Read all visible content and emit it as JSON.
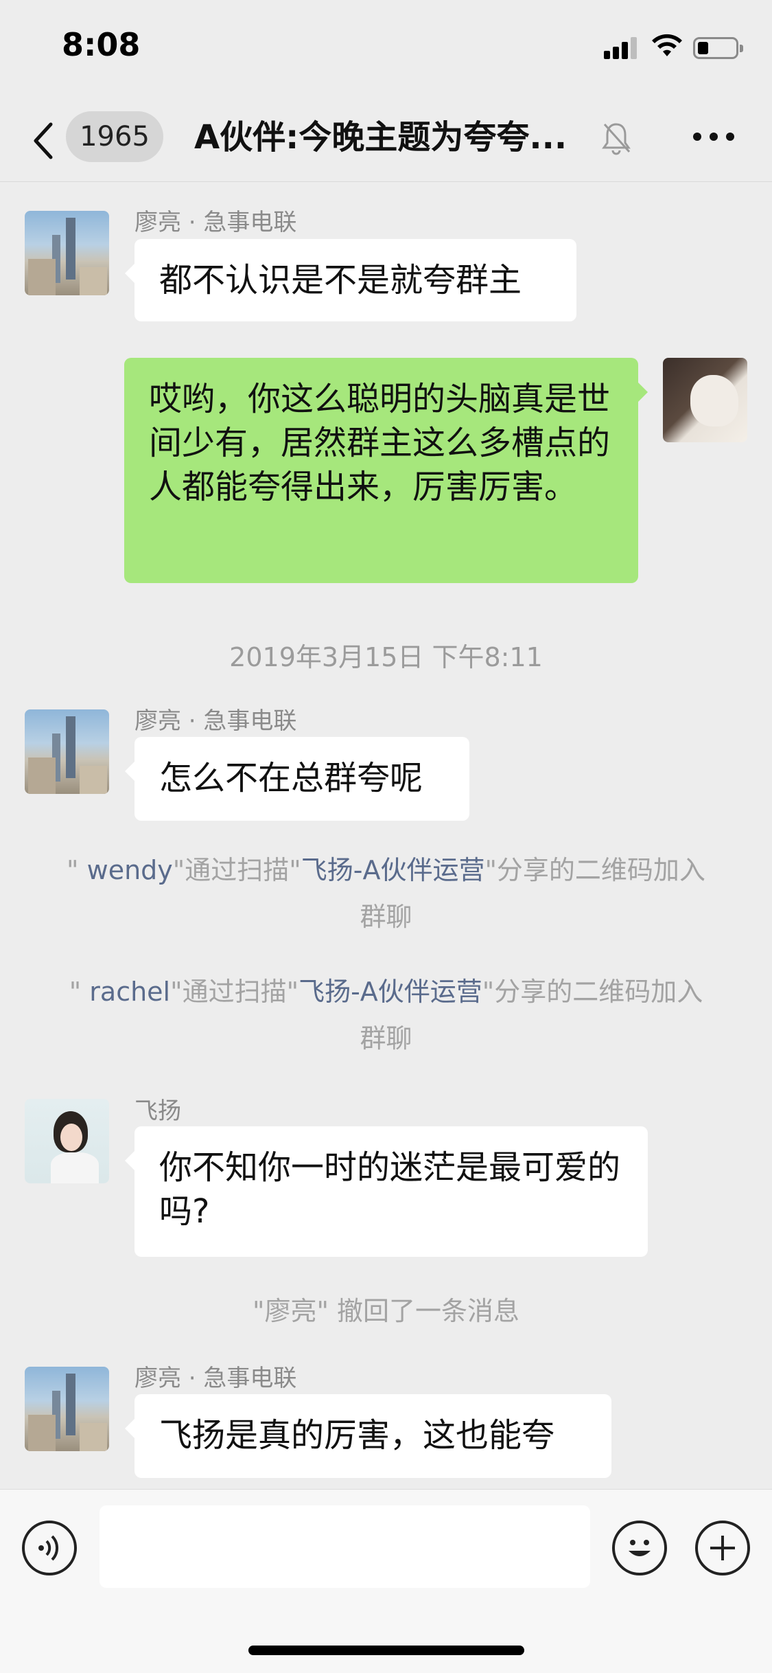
{
  "status_bar": {
    "time": "8:08"
  },
  "nav": {
    "unread_count": "1965",
    "title": "A伙伴:今晚主题为夸夸..."
  },
  "messages": [
    {
      "sender": "廖亮 · 急事电联",
      "text": "都不认识是不是就夸群主",
      "direction": "incoming"
    },
    {
      "text": "哎哟，你这么聪明的头脑真是世间少有，居然群主这么多槽点的人都能夸得出来，厉害厉害。",
      "direction": "outgoing"
    },
    {
      "sender": "廖亮 · 急事电联",
      "text": "怎么不在总群夸呢",
      "direction": "incoming"
    },
    {
      "sender": "飞扬",
      "text": "你不知你一时的迷茫是最可爱的吗?",
      "direction": "incoming"
    },
    {
      "sender": "廖亮 · 急事电联",
      "text": "飞扬是真的厉害，这也能夸",
      "direction": "incoming"
    }
  ],
  "timestamp": "2019年3月15日 下午8:11",
  "system_notes": [
    {
      "open_quote": "\" ",
      "nick": "wendy",
      "mid": "\"通过扫描\"",
      "link": "飞扬-A伙伴运营",
      "tail": "\"分享的二维码加入群聊"
    },
    {
      "open_quote": "\" ",
      "nick": "rachel",
      "mid": "\"通过扫描\"",
      "link": "飞扬-A伙伴运营",
      "tail": "\"分享的二维码加入群聊"
    }
  ],
  "recall_note": "\"廖亮\" 撤回了一条消息",
  "input": {
    "placeholder": ""
  },
  "icons": [
    "back-icon",
    "mute-bell-icon",
    "more-icon",
    "voice-icon",
    "emoji-icon",
    "plus-icon"
  ]
}
